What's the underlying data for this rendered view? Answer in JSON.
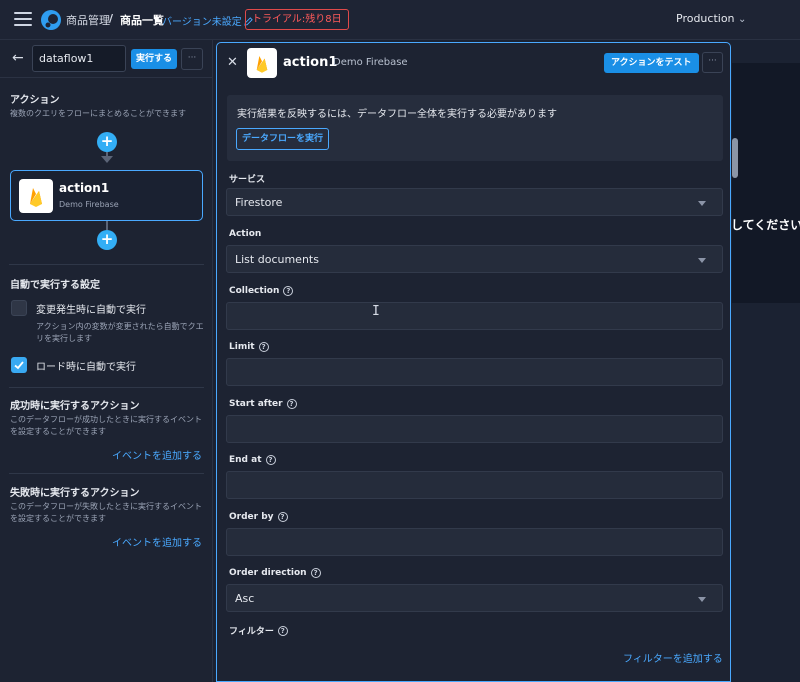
{
  "topbar": {
    "app_name": "商品管理",
    "separator": "/",
    "page_name": "商品一覧",
    "version_link": "バージョン未設定",
    "trial_badge": "トライアル:残り8日",
    "environment": "Production",
    "environment_caret": "⌄"
  },
  "sidebar": {
    "back_arrow": "←",
    "dataflow_name": "dataflow1",
    "run_button": "実行する",
    "more_glyph": "···",
    "actions_title": "アクション",
    "actions_desc": "複数のクエリをフローにまとめることができます",
    "add_symbol": "+",
    "action_card": {
      "name": "action1",
      "subtitle": "Demo Firebase"
    },
    "auto_run_title": "自動で実行する設定",
    "auto_on_change_label": "変更発生時に自動で実行",
    "auto_on_change_checked": false,
    "auto_on_change_desc": "アクション内の変数が変更されたら自動でクエリを実行します",
    "auto_on_load_label": "ロード時に自動で実行",
    "auto_on_load_checked": true,
    "success_title": "成功時に実行するアクション",
    "success_desc": "このデータフローが成功したときに実行するイベントを設定することができます",
    "success_link": "イベントを追加する",
    "failure_title": "失敗時に実行するアクション",
    "failure_desc": "このデータフローが失敗したときに実行するイベントを設定することができます",
    "failure_link": "イベントを追加する"
  },
  "background": {
    "partial_text": "してください"
  },
  "panel": {
    "close_glyph": "✕",
    "action_name": "action1",
    "action_source": "Demo Firebase",
    "test_button": "アクションをテスト",
    "more_glyph": "···",
    "notice_text": "実行結果を反映するには、データフロー全体を実行する必要があります",
    "notice_button": "データフローを実行",
    "fields": {
      "service": {
        "label": "サービス",
        "value": "Firestore"
      },
      "action": {
        "label": "Action",
        "value": "List documents"
      },
      "collection": {
        "label": "Collection",
        "value": ""
      },
      "limit": {
        "label": "Limit",
        "value": ""
      },
      "start_after": {
        "label": "Start after",
        "value": ""
      },
      "end_at": {
        "label": "End at",
        "value": ""
      },
      "order_by": {
        "label": "Order by",
        "value": ""
      },
      "order_direction": {
        "label": "Order direction",
        "value": "Asc"
      }
    },
    "filter_label": "フィルター",
    "help_glyph": "?",
    "add_filter_link": "フィルターを追加する"
  },
  "colors": {
    "accent": "#1a8fe6",
    "link": "#4aa9ff",
    "trial_red": "#e04a4a",
    "firebase_yellow": "#ffca28",
    "firebase_orange": "#f57c00"
  }
}
